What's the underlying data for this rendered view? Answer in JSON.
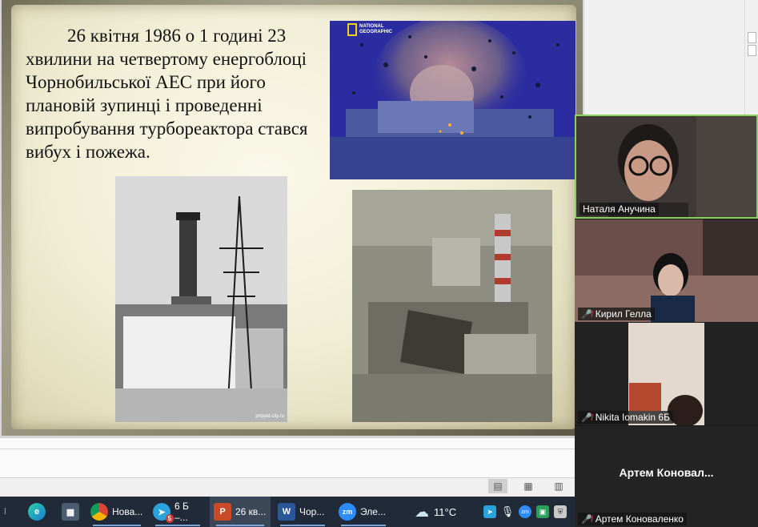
{
  "slide": {
    "paragraph": "26 квітня 1986 о 1 годині 23 хвилини на четвертому енергоблоці Чорнобильської АЕС при його плановій зупинці і проведенні випробування турбореактора стався вибух і пожежа.",
    "photo_fire_watermark": "NATIONAL GEOGRAPHIC",
    "photo_tower_caption": "pripyat-city.ru"
  },
  "participants": [
    {
      "name": "Наталя Анучина",
      "muted": false,
      "video": true
    },
    {
      "name": "Кирил Гелла",
      "muted": true,
      "video": true
    },
    {
      "name": "Nikita Iomakin 6Б",
      "muted": true,
      "video": true
    },
    {
      "name": "Артем Коноваленко",
      "display": "Артем  Коновал...",
      "muted": true,
      "video": false
    }
  ],
  "taskbar": {
    "items": [
      {
        "icon": "edge-icon",
        "label": ""
      },
      {
        "icon": "calculator-icon",
        "label": ""
      },
      {
        "icon": "chrome-icon",
        "label": "Нова..."
      },
      {
        "icon": "telegram-icon",
        "label": "6 Б –...",
        "badge": "5"
      },
      {
        "icon": "powerpoint-icon",
        "label": "26 кв...",
        "active": true
      },
      {
        "icon": "word-icon",
        "label": "Чор..."
      },
      {
        "icon": "zoom-icon",
        "label": "Эле..."
      }
    ],
    "weather": "11°C"
  },
  "colors": {
    "taskbar": "#202a38",
    "zoom_active_border": "#8ad05a",
    "muted_mic": "#e0303a"
  }
}
